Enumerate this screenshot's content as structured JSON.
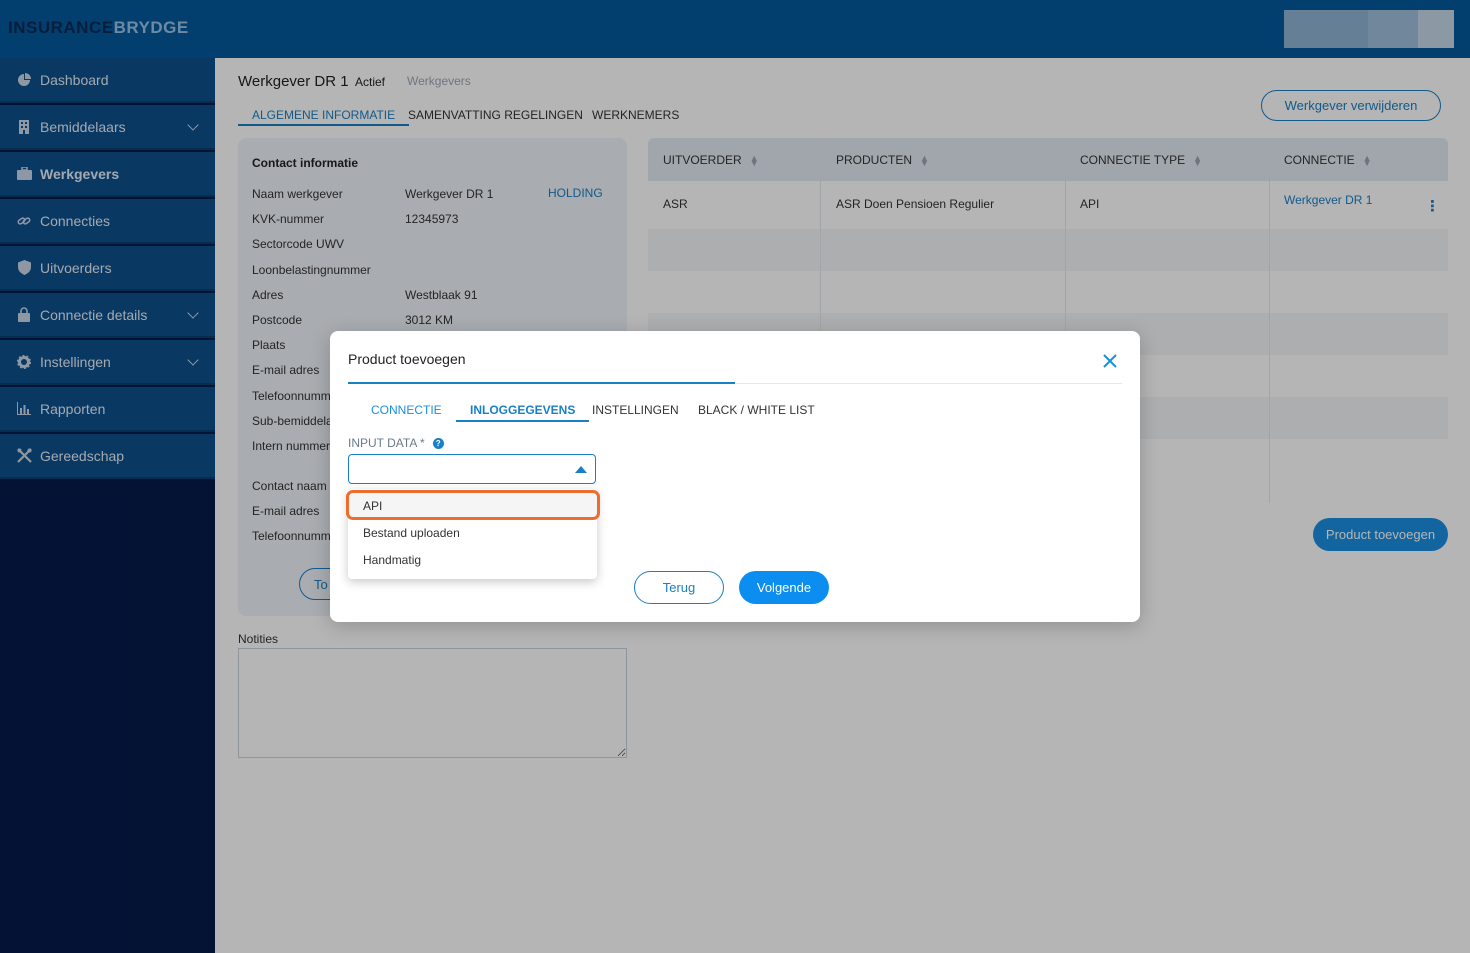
{
  "app": {
    "logo_part1": "INSURANCE",
    "logo_part2": "BRYDGE"
  },
  "sidebar": {
    "items": [
      {
        "label": "Dashboard",
        "icon": "pie-chart-icon"
      },
      {
        "label": "Bemiddelaars",
        "icon": "building-icon"
      },
      {
        "label": "Werkgevers",
        "icon": "briefcase-icon"
      },
      {
        "label": "Connecties",
        "icon": "link-icon"
      },
      {
        "label": "Uitvoerders",
        "icon": "shield-icon"
      },
      {
        "label": "Connectie details",
        "icon": "lock-icon"
      },
      {
        "label": "Instellingen",
        "icon": "gear-icon"
      },
      {
        "label": "Rapporten",
        "icon": "bar-chart-icon"
      },
      {
        "label": "Gereedschap",
        "icon": "tools-icon"
      }
    ]
  },
  "page": {
    "title": "Werkgever DR 1",
    "status": "Actief",
    "breadcrumb": "Werkgevers",
    "delete_button": "Werkgever verwijderen",
    "tabs": [
      "ALGEMENE INFORMATIE",
      "SAMENVATTING REGELINGEN",
      "WERKNEMERS"
    ]
  },
  "contact": {
    "heading": "Contact informatie",
    "holding": "HOLDING",
    "fields": [
      {
        "label": "Naam werkgever",
        "value": "Werkgever DR 1"
      },
      {
        "label": "KVK-nummer",
        "value": "12345973"
      },
      {
        "label": "Sectorcode UWV",
        "value": ""
      },
      {
        "label": "Loonbelastingnummer",
        "value": ""
      },
      {
        "label": "Adres",
        "value": "Westblaak 91"
      },
      {
        "label": "Postcode",
        "value": "3012 KM"
      },
      {
        "label": "Plaats",
        "value": ""
      },
      {
        "label": "E-mail adres",
        "value": ""
      },
      {
        "label": "Telefoonnumm",
        "value": ""
      },
      {
        "label": "Sub-bemiddela",
        "value": ""
      },
      {
        "label": "Intern nummer",
        "value": ""
      },
      {
        "label": "Contact naam",
        "value": ""
      },
      {
        "label": "E-mail adres",
        "value": ""
      },
      {
        "label": "Telefoonnumm",
        "value": ""
      }
    ],
    "button_partial": "To"
  },
  "notes": {
    "label": "Notities"
  },
  "table": {
    "columns": [
      "UITVOERDER",
      "PRODUCTEN",
      "CONNECTIE TYPE",
      "CONNECTIE"
    ],
    "rows": [
      {
        "uitvoerder": "ASR",
        "producten": "ASR Doen Pensioen Regulier",
        "type": "API",
        "connectie": "Werkgever DR 1"
      }
    ],
    "add_button": "Product toevoegen"
  },
  "modal": {
    "title": "Product toevoegen",
    "tabs": [
      "CONNECTIE",
      "INLOGGEGEVENS",
      "INSTELLINGEN",
      "BLACK / WHITE LIST"
    ],
    "input_label": "INPUT DATA *",
    "options": [
      "API",
      "Bestand uploaden",
      "Handmatig"
    ],
    "back_button": "Terug",
    "next_button": "Volgende"
  },
  "colors": {
    "topbar": "#045a9c",
    "sidebar": "#061a4a",
    "nav_item": "#0d4f8c",
    "accent": "#1a7fc4",
    "highlight": "#ef6c2f"
  }
}
